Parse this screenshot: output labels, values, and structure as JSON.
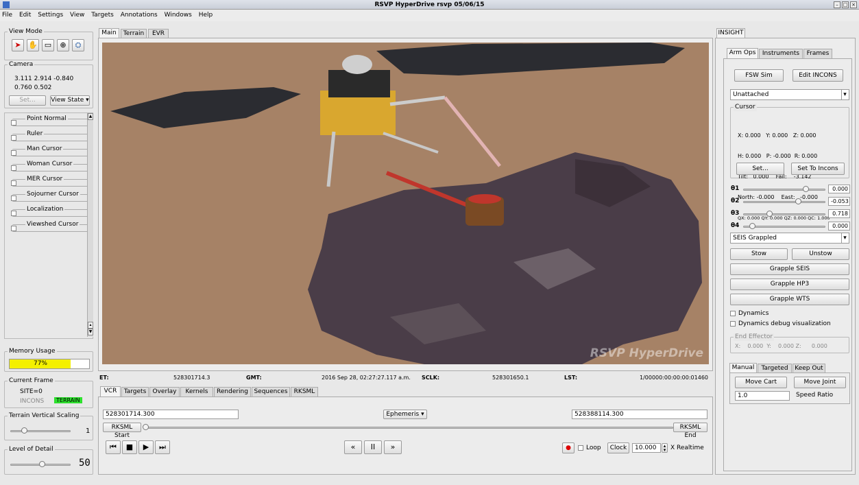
{
  "window": {
    "title": "RSVP HyperDrive rsvp 05/06/15"
  },
  "menu": [
    "File",
    "Edit",
    "Settings",
    "View",
    "Targets",
    "Annotations",
    "Windows",
    "Help"
  ],
  "left": {
    "view_mode_title": "View Mode",
    "camera_title": "Camera",
    "camera_vals": [
      "3.111  2.914  -0.840",
      "0.760  0.502"
    ],
    "set_label": "Set...",
    "view_state_label": "View State ▾",
    "cursors": [
      "Point Normal",
      "Ruler",
      "Man Cursor",
      "Woman Cursor",
      "MER Cursor",
      "Sojourner Cursor",
      "Localization",
      "Viewshed Cursor"
    ],
    "memory_title": "Memory Usage",
    "memory_text": "77%",
    "memory_fraction": 0.77,
    "frame_title": "Current Frame",
    "site": "SITE=0",
    "incons": "INCONS",
    "terrain_badge": "TERRAIN",
    "terrain_scaling_title": "Terrain Vertical Scaling",
    "terrain_scaling_value": "1",
    "lod_title": "Level of Detail",
    "lod_value": "50"
  },
  "center": {
    "tabs": [
      "Main",
      "Terrain",
      "EVR"
    ],
    "watermark": "RSVP HyperDrive",
    "time": {
      "et_label": "ET:",
      "et_value": "528301714.3",
      "gmt_label": "GMT:",
      "gmt_value": "2016 Sep 28, 02:27:27.117 a.m.",
      "sclk_label": "SCLK:",
      "sclk_value": "528301650.1",
      "lst_label": "LST:",
      "lst_value": "1/00000:00:00:00:01460"
    },
    "bottom_tabs": [
      "VCR",
      "Targets",
      "Overlay",
      "Kernels",
      "Rendering",
      "Sequences",
      "RKSML"
    ],
    "start_field": "528301714.300",
    "ephemeris": "Ephemeris",
    "end_field": "528388114.300",
    "rksml_start": "RKSML Start",
    "rksml_end": "RKSML End",
    "loop": "Loop",
    "clock": "Clock",
    "rate": "10.000",
    "realtime": "X Realtime"
  },
  "right": {
    "panel_tab": "INSIGHT",
    "tabs": [
      "Arm Ops",
      "Instruments",
      "Frames"
    ],
    "fsw_sim": "FSW Sim",
    "edit_incons": "Edit INCONS",
    "attach_select": "Unattached",
    "cursor_title": "Cursor",
    "cursor_lines": [
      "X: 0.000   Y: 0.000   Z: 0.000",
      "H: 0.000   P: -0.000  R: 0.000",
      "Tilt:   0.000    Fail:    -3.142",
      "North: -0.000    East:   -0.000",
      "QX: 0.000 QY: 0.000 QZ: 0.000 QC: 1.000"
    ],
    "set_btn": "Set...",
    "set_to_incons": "Set To Incons",
    "joints": [
      {
        "label": "θ1",
        "value": "0.000",
        "level": 0.78
      },
      {
        "label": "θ2",
        "value": "-0.053",
        "level": 0.68
      },
      {
        "label": "θ3",
        "value": "0.718",
        "level": 0.3
      },
      {
        "label": "θ4",
        "value": "0.000",
        "level": 0.08
      }
    ],
    "grapple_select": "SEIS Grappled",
    "stow": "Stow",
    "unstow": "Unstow",
    "grapple_seis": "Grapple SEIS",
    "grapple_hp3": "Grapple HP3",
    "grapple_wts": "Grapple WTS",
    "dynamics": "Dynamics",
    "dynamics_debug": "Dynamics debug visualization",
    "end_effector_title": "End Effector",
    "end_effector": "X:    0.000  Y:    0.000 Z:      0.000",
    "mode_tabs": [
      "Manual",
      "Targeted",
      "Keep Out"
    ],
    "move_cart": "Move Cart",
    "move_joint": "Move Joint",
    "speed_value": "1.0",
    "speed_label": "Speed Ratio"
  }
}
